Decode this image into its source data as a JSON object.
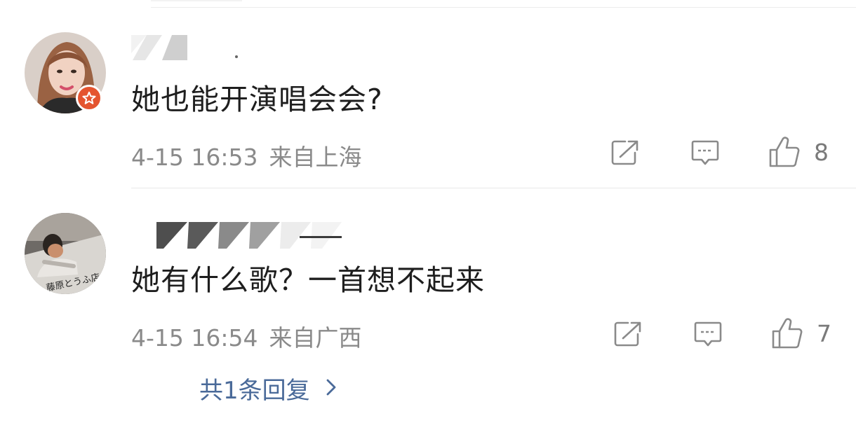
{
  "comments": [
    {
      "text": "她也能开演唱会会?",
      "time": "4-15 16:53",
      "location": "来自上海",
      "likes": "8",
      "verified": true,
      "username_masked": true
    },
    {
      "text": "她有什么歌？一首想不起来",
      "time": "4-15 16:54",
      "location": "来自广西",
      "likes": "7",
      "verified": false,
      "username_masked": true,
      "avatar_caption": "藤原とうふ店"
    }
  ],
  "reply_summary": {
    "label": "共1条回复"
  },
  "colors": {
    "link": "#4a6a99",
    "meta": "#8a8a8a",
    "badge": "#e4542f"
  },
  "icons": [
    "repost-icon",
    "comment-icon",
    "like-icon",
    "verified-badge-icon",
    "chevron-right-icon"
  ]
}
